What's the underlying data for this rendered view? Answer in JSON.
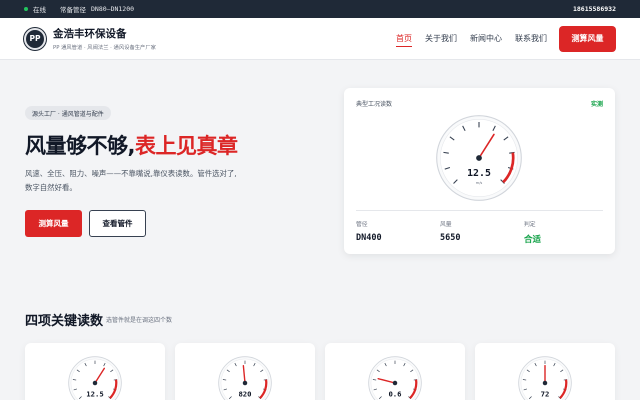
{
  "topbar": {
    "status": "在线",
    "stock_label": "常备管径",
    "stock_range": "DN80–DN1200",
    "phone": "18615586932"
  },
  "nav": {
    "logo_text": "PP",
    "brand_name": "金浩丰环保设备",
    "brand_tagline": "PP 通风管道 · 风阀法兰 · 通风设备生产厂家",
    "menu": [
      "首页",
      "关于我们",
      "新闻中心",
      "联系我们"
    ],
    "active_index": 0,
    "cta": "测算风量"
  },
  "hero": {
    "badge": "源头工厂 · 通风管道与配件",
    "title_part1": "风量够不够,",
    "title_part2": "表上见真章",
    "description": "风速、全压、阻力、噪声——不靠嘴说,靠仪表读数。管件选对了,数字自然好看。",
    "primary_button": "测算风量",
    "secondary_button": "查看管件"
  },
  "gauge_card": {
    "title": "典型工况读数",
    "status": "实测",
    "reading": "12.5",
    "unit": "m/s",
    "value_fraction": 0.62,
    "stats": [
      {
        "label": "管径",
        "value": "DN400"
      },
      {
        "label": "风量",
        "value": "5650"
      },
      {
        "label": "判定",
        "value": "合适"
      }
    ]
  },
  "section": {
    "title": "四项关键读数",
    "subtitle": "选管件就是在调这四个数"
  },
  "mini_gauges": [
    {
      "reading": "12.5",
      "value_fraction": 0.62
    },
    {
      "reading": "820",
      "value_fraction": 0.48
    },
    {
      "reading": "0.6",
      "value_fraction": 0.22
    },
    {
      "reading": "72",
      "value_fraction": 0.5
    }
  ],
  "colors": {
    "accent": "#dc2626",
    "dark": "#1f2937",
    "success": "#16a34a"
  }
}
